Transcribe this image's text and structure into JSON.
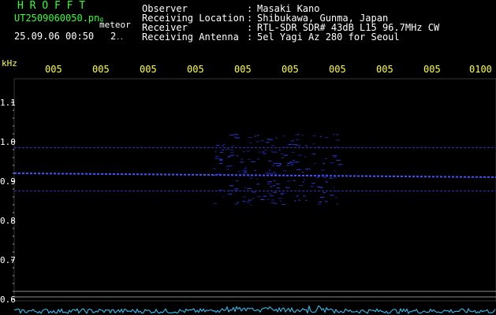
{
  "header": {
    "app_title": "H R O F F T",
    "filename": "UT2509060050.pn",
    "filename_trail": "g",
    "meteor_label": "meteor",
    "timestamp": "25.09.06 00:50",
    "count": "2"
  },
  "info": [
    {
      "key": "Observer",
      "value": "Masaki Kano"
    },
    {
      "key": "Receiving Location",
      "value": "Shibukawa, Gunma, Japan"
    },
    {
      "key": "Receiver",
      "value": "RTL-SDR SDR# 43dB L15 96.7MHz CW"
    },
    {
      "key": "Receiving Antenna",
      "value": "5el Yagi Az 280 for Seoul"
    }
  ],
  "colon": ":",
  "chart_data": {
    "type": "heatmap",
    "ylabel": "kHz",
    "y_ticks": [
      "1.1",
      "1.0",
      "0.9",
      "0.8",
      "0.7",
      "0.6"
    ],
    "x_ticks": [
      "005",
      "005",
      "005",
      "005",
      "005",
      "005",
      "005",
      "005",
      "005",
      "0100"
    ],
    "ylim": [
      0.58,
      1.14
    ],
    "signal_lines_khz": [
      0.985,
      0.92,
      0.875
    ],
    "meteor_burst_khz_range": [
      0.84,
      1.02
    ]
  },
  "colors": {
    "background": "#000000",
    "header_green": "#33ff33",
    "text_white": "#ffffff",
    "tick_yellow": "#ffff33",
    "signal_blue": "#3344ff",
    "power_cyan": "#33ccff"
  }
}
